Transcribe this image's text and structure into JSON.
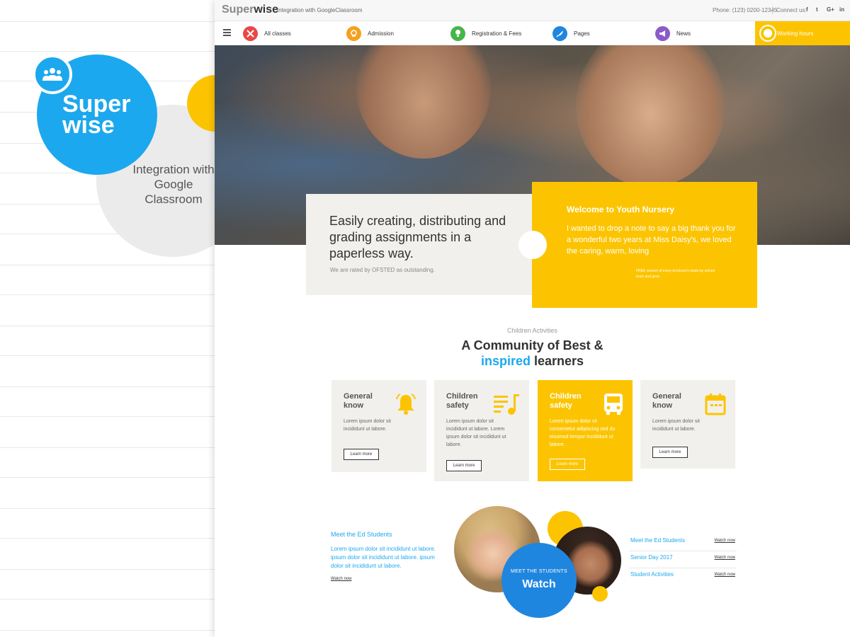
{
  "branding": {
    "title": "Super wise",
    "subtitle": "Integration with Google Classroom"
  },
  "topbar": {
    "logo_gray": "Super",
    "logo_dark": "wise",
    "tagline": "Integration with GoogleClassroom",
    "phone": "Phone: (123) 0200-12345",
    "connect": "Connect us:",
    "social": [
      "f",
      "t",
      "G+",
      "in"
    ]
  },
  "nav": {
    "items": [
      {
        "label": "All classes",
        "color": "#e84848",
        "icon": "pencil-ruler-icon"
      },
      {
        "label": "Admission",
        "color": "#f4a11e",
        "icon": "admission-icon"
      },
      {
        "label": "Registration & Fees",
        "color": "#45b649",
        "icon": "lightbulb-icon"
      },
      {
        "label": "Pages",
        "color": "#1f86e0",
        "icon": "rocket-icon"
      },
      {
        "label": "News",
        "color": "#8b5bc7",
        "icon": "megaphone-icon"
      }
    ],
    "hours_label": "Working hours"
  },
  "hero": {
    "card_title": "Easily creating, distributing and grading assignments in a paperless way.",
    "card_note": "We are rated by OFSTED as outstanding.",
    "welcome_title": "Welcome to Youth Nursery",
    "welcome_body": "I wanted to drop a note to say a big thank you for a wonderful two years at Miss Daisy's, we loved the caring, warm, loving",
    "welcome_note": "FREE version of every brochure's made by school team and grow"
  },
  "activities": {
    "kicker": "Children Activities",
    "title_line1": "A Community of Best &",
    "title_highlight": "inspired",
    "title_rest": "learners",
    "cards": [
      {
        "title": "General know",
        "body": "Lorem ipsum dolor sit incididunt ut labore.",
        "button": "Learn more",
        "icon": "bell-icon"
      },
      {
        "title": "Children safety",
        "body": "Lorem ipsum dolor sit incididunt ut labore. Lorem ipsum dolor sit incididunt ut labore.",
        "button": "Learn more",
        "icon": "playlist-music-icon"
      },
      {
        "title": "Children safety",
        "body": "Lorem ipsum dolor sit consectetur adipiscing sed do eiusmod tempor incididunt ut labore.",
        "button": "Learn more",
        "icon": "bus-icon"
      },
      {
        "title": "General know",
        "body": "Lorem ipsum dolor sit incididunt ut labore.",
        "button": "Learn more",
        "icon": "calendar-icon"
      }
    ]
  },
  "students": {
    "title": "Meet the Ed Students",
    "body": "Lorem ipsum dolor sit incididunt ut labore. ipsum dolor sit incididunt ut labore. ipsum dolor sit incididunt ut labore.",
    "watch_link": "Watch now",
    "circle_kicker": "MEET THE STUDENTS",
    "circle_big": "Watch",
    "videos": [
      {
        "title": "Meet the Ed Students",
        "watch": "Watch now"
      },
      {
        "title": "Senior Day 2017",
        "watch": "Watch now"
      },
      {
        "title": "Student Activities",
        "watch": "Watch now"
      }
    ]
  },
  "colors": {
    "blue": "#1ca8ee",
    "yellow": "#fcc400",
    "deep_blue": "#1f86e0"
  }
}
